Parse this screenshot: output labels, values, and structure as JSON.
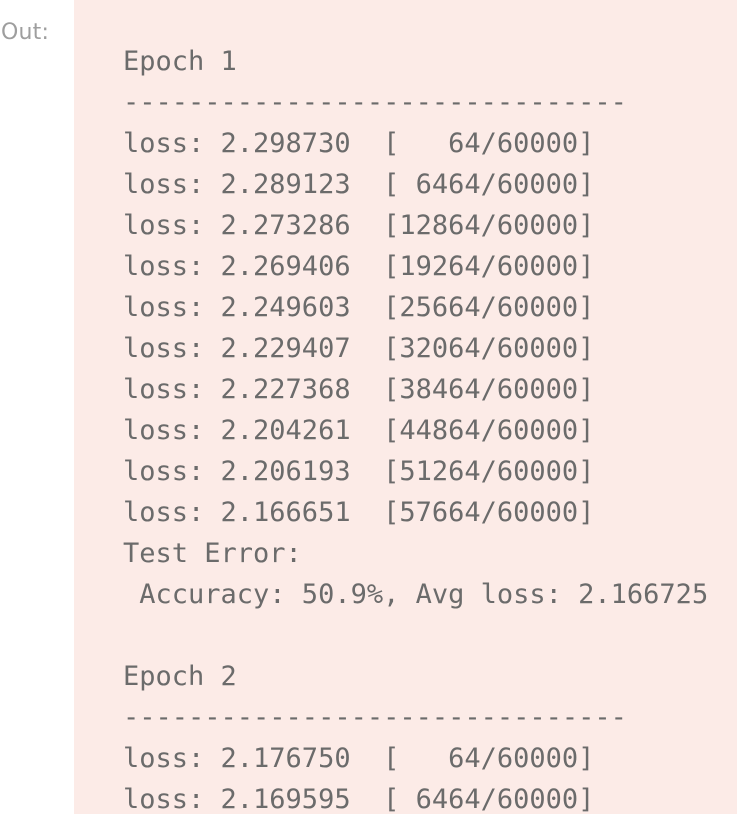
{
  "prompt": "Out:",
  "output": {
    "lines": [
      "Epoch 1",
      "-------------------------------",
      "loss: 2.298730  [   64/60000]",
      "loss: 2.289123  [ 6464/60000]",
      "loss: 2.273286  [12864/60000]",
      "loss: 2.269406  [19264/60000]",
      "loss: 2.249603  [25664/60000]",
      "loss: 2.229407  [32064/60000]",
      "loss: 2.227368  [38464/60000]",
      "loss: 2.204261  [44864/60000]",
      "loss: 2.206193  [51264/60000]",
      "loss: 2.166651  [57664/60000]",
      "Test Error: ",
      " Accuracy: 50.9%, Avg loss: 2.166725 ",
      "",
      "Epoch 2",
      "-------------------------------",
      "loss: 2.176750  [   64/60000]",
      "loss: 2.169595  [ 6464/60000]"
    ]
  }
}
